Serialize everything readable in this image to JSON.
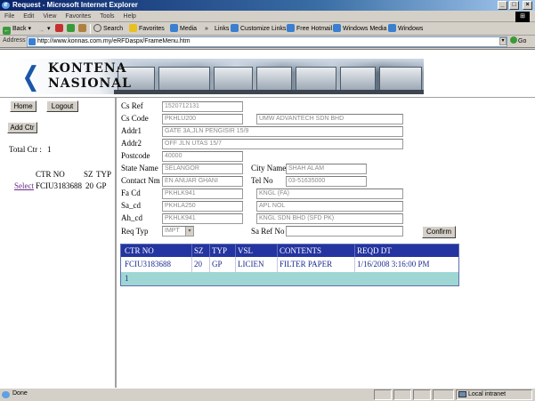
{
  "window": {
    "title": "Request - Microsoft Internet Explorer",
    "controls": [
      "_",
      "□",
      "×"
    ]
  },
  "menu": [
    "File",
    "Edit",
    "View",
    "Favorites",
    "Tools",
    "Help"
  ],
  "toolbar": {
    "back": "Back",
    "search": "Search",
    "favorites": "Favorites",
    "media": "Media",
    "links": "Links",
    "customize_links": "Customize Links",
    "free_hotmail": "Free Hotmail",
    "windows_media": "Windows Media",
    "windows": "Windows"
  },
  "address": {
    "label": "Address",
    "url": "http://www.konnas.com.my/eRFDaspx/FrameMenu.htm",
    "go": "Go"
  },
  "banner": {
    "line1": "KONTENA",
    "line2": "NASIONAL"
  },
  "left": {
    "home": "Home",
    "logout": "Logout",
    "add_ctr": "Add Ctr",
    "total_ctr_label": "Total Ctr :",
    "total_ctr_value": "1",
    "headers": [
      "CTR NO",
      "SZ",
      "TYP"
    ],
    "row": {
      "link": "Select",
      "ctr_no": "FCIU3183688",
      "sz": "20",
      "typ": "GP"
    }
  },
  "form": {
    "cs_ref": {
      "label": "Cs Ref",
      "value": "1520712131"
    },
    "cs_code": {
      "label": "Cs Code",
      "value": "PKHLU200",
      "name": "UMW ADVANTECH SDN BHD"
    },
    "addr1": {
      "label": "Addr1",
      "value": "GATE 3A,JLN PENGISIR 15/9"
    },
    "addr2": {
      "label": "Addr2",
      "value": "OFF JLN UTAS 15/7"
    },
    "postcode": {
      "label": "Postcode",
      "value": "40000"
    },
    "state": {
      "label": "State Name",
      "value": "SELANGOR"
    },
    "city": {
      "label": "City Name",
      "value": "SHAH ALAM"
    },
    "contact": {
      "label": "Contact Nm",
      "value": "EN ANUAR GHANI"
    },
    "tel": {
      "label": "Tel No",
      "value": "03-51635000"
    },
    "fa_cd": {
      "label": "Fa Cd",
      "value": "PKHLK941",
      "name": "KNGL (FA)"
    },
    "sa_cd": {
      "label": "Sa_cd",
      "value": "PKHLA250",
      "name": "APL NOL"
    },
    "ah_cd": {
      "label": "Ah_cd",
      "value": "PKHLK941",
      "name": "KNGL SDN BHD (SFD PK)"
    },
    "req_typ": {
      "label": "Req Typ",
      "value": "IMPT"
    },
    "sa_ref": {
      "label": "Sa Ref No",
      "value": ""
    },
    "confirm": "Confirm"
  },
  "grid": {
    "headers": [
      "CTR NO",
      "SZ",
      "TYP",
      "VSL",
      "CONTENTS",
      "REQD DT"
    ],
    "row": [
      "FCIU3183688",
      "20",
      "GP",
      "LICIEN",
      "FILTER PAPER",
      "1/16/2008 3:16:00 PM"
    ],
    "footer": "1"
  },
  "status": {
    "text": "Done",
    "zone": "Local intranet"
  }
}
